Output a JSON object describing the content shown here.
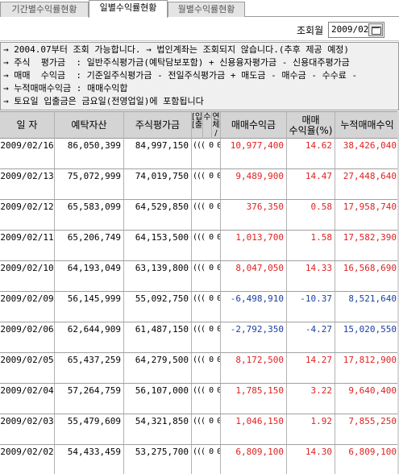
{
  "tabs": [
    {
      "label": "기간별수익률현황",
      "active": false
    },
    {
      "label": "일별수익률현황",
      "active": true
    },
    {
      "label": "월별수익률현황",
      "active": false
    }
  ],
  "filter": {
    "label": "조회월",
    "date_value": "2009/02"
  },
  "notes": [
    "→ 2004.07부터 조회 가능합니다. → 법인계좌는 조회되지 않습니다.(추후 제공 예정)",
    "→ 주식  평가금  : 일반주식평가금(예탁담보포함) + 신용융자평가금 - 신용대주평가금",
    "→ 매매  수익금  : 기준일주식평가금 - 전일주식평가금 + 매도금 - 매수금 - 수수료 -",
    "→ 누적매매수익금 : 매매수익합",
    "→ 토요일 입출금은 금요일(전영업일)에 포함됩니다"
  ],
  "table": {
    "headers": {
      "date": "일 자",
      "deposit": "예탁자산",
      "stock_eval": "주식평가금",
      "narrow1": "[입\n[출",
      "narrow2": "수\n",
      "narrow3": "연\n체\n/",
      "trade_profit": "매매수익금",
      "trade_rate": "매매\n수익율(%)",
      "cum_profit": "누적매매수익"
    },
    "rows": [
      {
        "date": "2009/02/16",
        "deposit": "86,050,399",
        "stock_eval": "84,997,150",
        "mini": "((( 0 0",
        "trade_profit": "10,977,400",
        "trade_rate": "14.62",
        "cum_profit": "38,426,040",
        "sign": "pos"
      },
      {
        "date": "2009/02/13",
        "deposit": "75,072,999",
        "stock_eval": "74,019,750",
        "mini": "((( 0 0",
        "trade_profit": "9,489,900",
        "trade_rate": "14.47",
        "cum_profit": "27,448,640",
        "sign": "pos"
      },
      {
        "date": "2009/02/12",
        "deposit": "65,583,099",
        "stock_eval": "64,529,850",
        "mini": "((( 0 0",
        "trade_profit": "376,350",
        "trade_rate": "0.58",
        "cum_profit": "17,958,740",
        "sign": "pos"
      },
      {
        "date": "2009/02/11",
        "deposit": "65,206,749",
        "stock_eval": "64,153,500",
        "mini": "((( 0 0",
        "trade_profit": "1,013,700",
        "trade_rate": "1.58",
        "cum_profit": "17,582,390",
        "sign": "pos"
      },
      {
        "date": "2009/02/10",
        "deposit": "64,193,049",
        "stock_eval": "63,139,800",
        "mini": "((( 0 0",
        "trade_profit": "8,047,050",
        "trade_rate": "14.33",
        "cum_profit": "16,568,690",
        "sign": "pos"
      },
      {
        "date": "2009/02/09",
        "deposit": "56,145,999",
        "stock_eval": "55,092,750",
        "mini": "((( 0 0",
        "trade_profit": "-6,498,910",
        "trade_rate": "-10.37",
        "cum_profit": "8,521,640",
        "sign": "neg"
      },
      {
        "date": "2009/02/06",
        "deposit": "62,644,909",
        "stock_eval": "61,487,150",
        "mini": "((( 0 0",
        "trade_profit": "-2,792,350",
        "trade_rate": "-4.27",
        "cum_profit": "15,020,550",
        "sign": "neg"
      },
      {
        "date": "2009/02/05",
        "deposit": "65,437,259",
        "stock_eval": "64,279,500",
        "mini": "((( 0 0",
        "trade_profit": "8,172,500",
        "trade_rate": "14.27",
        "cum_profit": "17,812,900",
        "sign": "pos"
      },
      {
        "date": "2009/02/04",
        "deposit": "57,264,759",
        "stock_eval": "56,107,000",
        "mini": "((( 0 0",
        "trade_profit": "1,785,150",
        "trade_rate": "3.22",
        "cum_profit": "9,640,400",
        "sign": "pos"
      },
      {
        "date": "2009/02/03",
        "deposit": "55,479,609",
        "stock_eval": "54,321,850",
        "mini": "((( 0 0",
        "trade_profit": "1,046,150",
        "trade_rate": "1.92",
        "cum_profit": "7,855,250",
        "sign": "pos"
      },
      {
        "date": "2009/02/02",
        "deposit": "54,433,459",
        "stock_eval": "53,275,700",
        "mini": "((( 0 0",
        "trade_profit": "6,809,100",
        "trade_rate": "14.30",
        "cum_profit": "6,809,100",
        "sign": "pos"
      }
    ]
  },
  "colors": {
    "positive": "#e02020",
    "negative": "#1a3fa0",
    "header_bg": "#d4d4d4",
    "notes_bg": "#f0f0f0"
  }
}
